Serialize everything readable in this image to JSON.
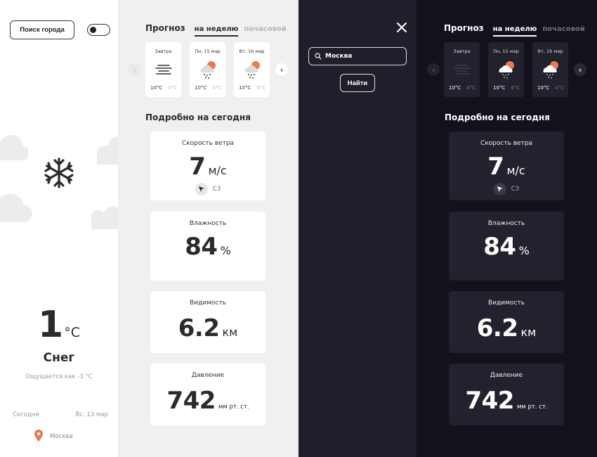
{
  "light": {
    "search_button": "Поиск города",
    "temperature": "1",
    "temp_unit": "°C",
    "condition": "Снег",
    "feels_like": "Ощущается как -3 °C",
    "date_label": "Сегодня",
    "date_value": "Вс, 13 мар",
    "location": "Москва",
    "tabs": {
      "title": "Прогноз",
      "week": "на неделю",
      "hourly": "почасовой"
    },
    "forecast": [
      {
        "day": "Завтра",
        "hi": "10°C",
        "lo": "4°C",
        "icon": "fog-icon"
      },
      {
        "day": "Пн, 15 мар",
        "hi": "10°C",
        "lo": "4°C",
        "icon": "sun-cloud-rain-icon"
      },
      {
        "day": "Вт, 16 мар",
        "hi": "10°C",
        "lo": "4°C",
        "icon": "sun-cloud-rain-icon"
      }
    ],
    "details_title": "Подробно на сегодня",
    "details": {
      "wind": {
        "label": "Скорость ветра",
        "value": "7",
        "unit": "м/с",
        "direction": "СЗ"
      },
      "humidity": {
        "label": "Влажность",
        "value": "84",
        "unit": "%"
      },
      "visibility": {
        "label": "Видимость",
        "value": "6.2",
        "unit": "км"
      },
      "pressure": {
        "label": "Давление",
        "value": "742",
        "unit": "мм рт. ст."
      }
    }
  },
  "dark": {
    "search_value": "Москва",
    "find_button": "Найти",
    "tabs": {
      "title": "Прогноз",
      "week": "на неделю",
      "hourly": "почасовой"
    },
    "forecast": [
      {
        "day": "Завтра",
        "hi": "10°C",
        "lo": "4°C",
        "icon": "fog-icon"
      },
      {
        "day": "Пн, 15 мар",
        "hi": "10°C",
        "lo": "4°C",
        "icon": "sun-cloud-rain-icon"
      },
      {
        "day": "Вт, 16 мар",
        "hi": "10°C",
        "lo": "4°C",
        "icon": "sun-cloud-rain-icon"
      }
    ],
    "details_title": "Подробно на сегодня",
    "details": {
      "wind": {
        "label": "Скорость ветра",
        "value": "7",
        "unit": "м/с",
        "direction": "СЗ"
      },
      "humidity": {
        "label": "Влажность",
        "value": "84",
        "unit": "%"
      },
      "visibility": {
        "label": "Видимость",
        "value": "6.2",
        "unit": "км"
      },
      "pressure": {
        "label": "Давление",
        "value": "742",
        "unit": "мм рт. ст."
      }
    }
  },
  "colors": {
    "accent_orange": "#f07850",
    "light_text": "#2b2b2b",
    "light_bg": "#f0f0f0",
    "dark_panel": "#1f1f2b",
    "dark_bg": "#12111c",
    "dark_card": "#22222e"
  }
}
